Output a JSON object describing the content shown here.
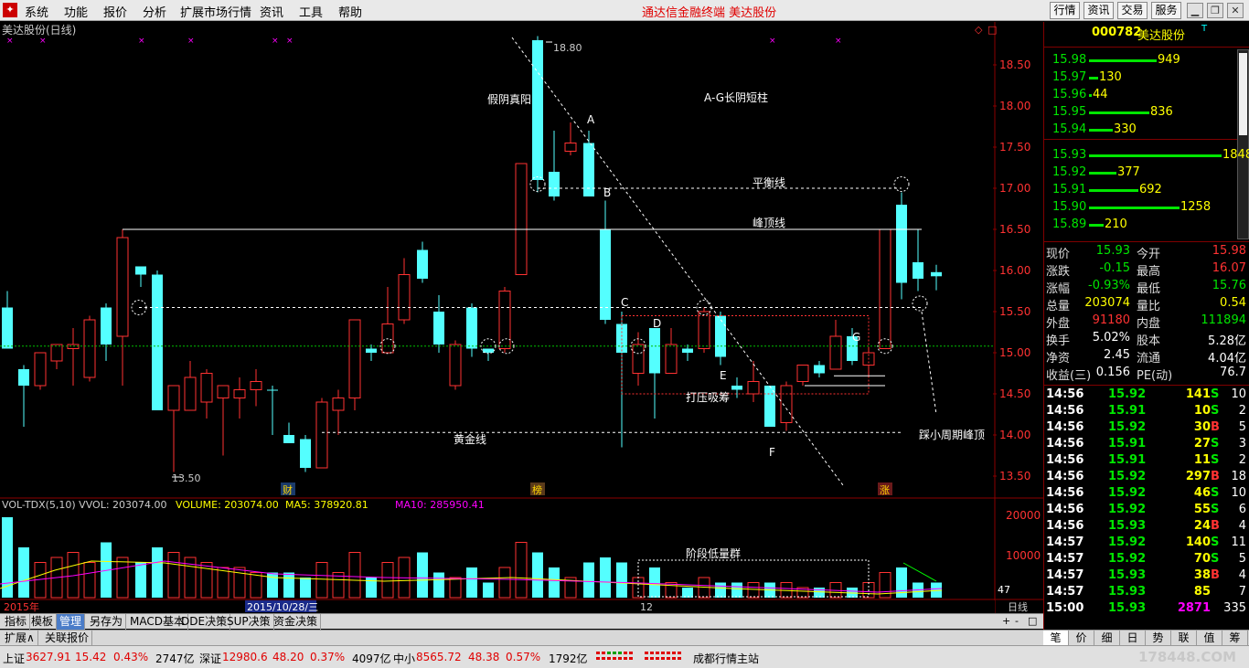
{
  "menu": {
    "items": [
      "系统",
      "功能",
      "报价",
      "分析",
      "扩展市场行情",
      "资讯",
      "工具",
      "帮助"
    ],
    "center_title": "通达信金融终端   美达股份",
    "right_buttons": [
      "行情",
      "资讯",
      "交易",
      "服务"
    ]
  },
  "chart": {
    "title": "美达股份(日线)",
    "price_axis": [
      "18.50",
      "18.00",
      "17.50",
      "17.00",
      "16.50",
      "16.00",
      "15.50",
      "15.00",
      "14.50",
      "14.00",
      "13.50"
    ],
    "volume_axis": [
      "20000",
      "10000"
    ],
    "volume_current_label": "47",
    "indicator_line": {
      "name": "VOL-TDX(5,10) VVOL: 203074.00",
      "volume": "VOLUME: 203074.00",
      "ma5": "MA5: 378920.81",
      "ma10": "MA10: 285950.41"
    },
    "annotations": {
      "high_price": "18.80",
      "low_price": "13.50",
      "fake_yin": "假阴真阳",
      "ag_short": "A-G长阴短柱",
      "balance": "平衡线",
      "peak": "峰顶线",
      "gold": "黄金线",
      "press": "打压吸筹",
      "step_small_peak": "踩小周期峰顶",
      "low_volume": "阶段低量群",
      "A": "A",
      "B": "B",
      "C": "C",
      "D": "D",
      "E": "E",
      "F": "F",
      "G": "G",
      "cai": "财",
      "bang": "榜",
      "zhang": "涨"
    },
    "date_axis": {
      "year": "2015年",
      "cursor_date": "2015/10/28/三",
      "month": "12",
      "period": "日线"
    }
  },
  "quote": {
    "code": "000782",
    "name": "美达股份",
    "asks": [
      {
        "price": "15.98",
        "vol": "949"
      },
      {
        "price": "15.97",
        "vol": "130"
      },
      {
        "price": "15.96",
        "vol": "44"
      },
      {
        "price": "15.95",
        "vol": "836"
      },
      {
        "price": "15.94",
        "vol": "330"
      }
    ],
    "bids": [
      {
        "price": "15.93",
        "vol": "1848"
      },
      {
        "price": "15.92",
        "vol": "377"
      },
      {
        "price": "15.91",
        "vol": "692"
      },
      {
        "price": "15.90",
        "vol": "1258"
      },
      {
        "price": "15.89",
        "vol": "210"
      }
    ],
    "stats": [
      {
        "l1": "现价",
        "v1": "15.93",
        "l2": "今开",
        "v2": "15.98"
      },
      {
        "l1": "涨跌",
        "v1": "-0.15",
        "l2": "最高",
        "v2": "16.07"
      },
      {
        "l1": "涨幅",
        "v1": "-0.93%",
        "l2": "最低",
        "v2": "15.76"
      },
      {
        "l1": "总量",
        "v1": "203074",
        "l2": "量比",
        "v2": "0.54"
      },
      {
        "l1": "外盘",
        "v1": "91180",
        "l2": "内盘",
        "v2": "111894"
      },
      {
        "l1": "换手",
        "v1": "5.02%",
        "l2": "股本",
        "v2": "5.28亿"
      },
      {
        "l1": "净资",
        "v1": "2.45",
        "l2": "流通",
        "v2": "4.04亿"
      },
      {
        "l1": "收益(三)",
        "v1": "0.156",
        "l2": "PE(动)",
        "v2": "76.7"
      }
    ],
    "ticks": [
      {
        "t": "14:56",
        "p": "15.92",
        "v": "141",
        "s": "S",
        "n": "10"
      },
      {
        "t": "14:56",
        "p": "15.91",
        "v": "10",
        "s": "S",
        "n": "2"
      },
      {
        "t": "14:56",
        "p": "15.92",
        "v": "30",
        "s": "B",
        "n": "5"
      },
      {
        "t": "14:56",
        "p": "15.91",
        "v": "27",
        "s": "S",
        "n": "3"
      },
      {
        "t": "14:56",
        "p": "15.91",
        "v": "11",
        "s": "S",
        "n": "2"
      },
      {
        "t": "14:56",
        "p": "15.92",
        "v": "297",
        "s": "B",
        "n": "18"
      },
      {
        "t": "14:56",
        "p": "15.92",
        "v": "46",
        "s": "S",
        "n": "10"
      },
      {
        "t": "14:56",
        "p": "15.92",
        "v": "55",
        "s": "S",
        "n": "6"
      },
      {
        "t": "14:56",
        "p": "15.93",
        "v": "24",
        "s": "B",
        "n": "4"
      },
      {
        "t": "14:57",
        "p": "15.92",
        "v": "140",
        "s": "S",
        "n": "11"
      },
      {
        "t": "14:57",
        "p": "15.92",
        "v": "70",
        "s": "S",
        "n": "5"
      },
      {
        "t": "14:57",
        "p": "15.93",
        "v": "38",
        "s": "B",
        "n": "4"
      },
      {
        "t": "14:57",
        "p": "15.93",
        "v": "85",
        "s": "",
        "n": "7"
      },
      {
        "t": "15:00",
        "p": "15.93",
        "v": "2871",
        "s": "",
        "n": "335"
      }
    ],
    "tabs": [
      "笔",
      "价",
      "细",
      "日",
      "势",
      "联",
      "值",
      "筹"
    ]
  },
  "bottom_tabs": [
    "指标",
    "模板",
    "管理",
    "另存为",
    "MACD基本",
    "DDE决策",
    "SUP决策",
    "资金决策"
  ],
  "sub_tabs": [
    "扩展∧",
    "关联报价"
  ],
  "status": {
    "sh_label": "上证",
    "sh_val": "3627.91",
    "sh_chg": "15.42",
    "sh_pct": "0.43%",
    "sh_amt": "2747亿",
    "sz_label": "深证",
    "sz_val": "12980.6",
    "sz_chg": "48.20",
    "sz_pct": "0.37%",
    "sz_amt": "4097亿",
    "zx_label": "中小",
    "zx_val": "8565.72",
    "zx_chg": "48.38",
    "zx_pct": "0.57%",
    "zx_amt": "1792亿",
    "station": "成都行情主站",
    "watermark": "178448.COM"
  }
}
